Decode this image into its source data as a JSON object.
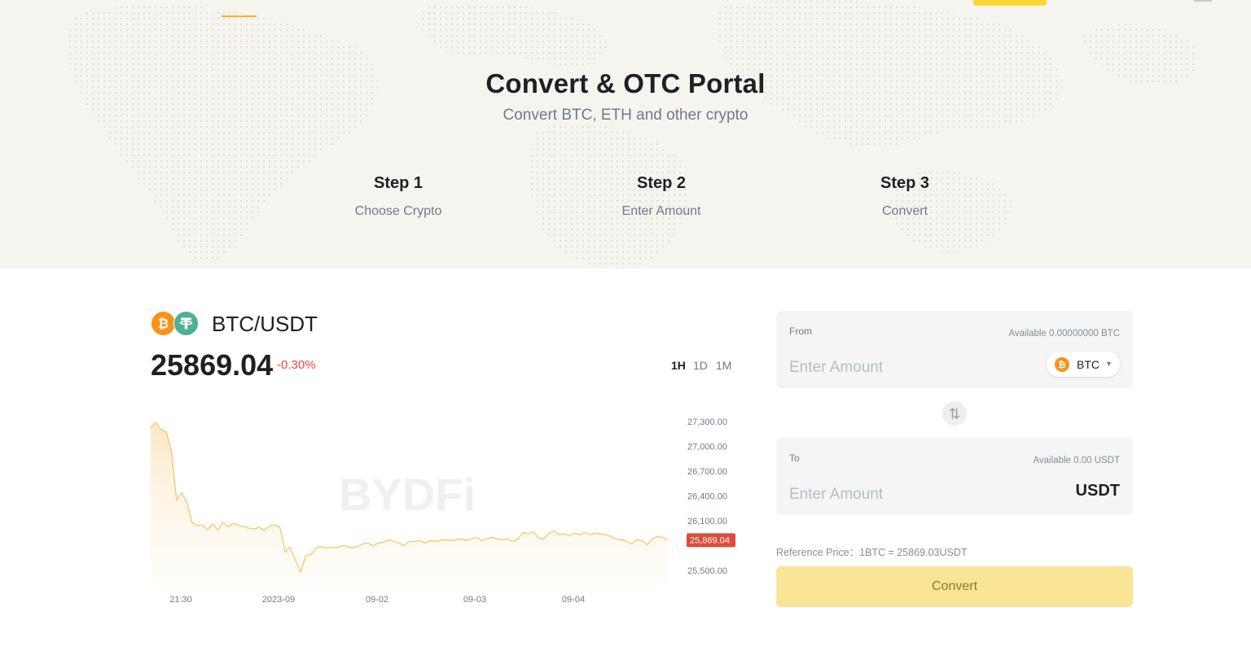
{
  "hero": {
    "title": "Convert & OTC Portal",
    "subtitle": "Convert BTC, ETH and other crypto",
    "steps": [
      {
        "title": "Step 1",
        "desc": "Choose Crypto"
      },
      {
        "title": "Step 2",
        "desc": "Enter Amount"
      },
      {
        "title": "Step 3",
        "desc": "Convert"
      }
    ]
  },
  "pair": {
    "name": "BTC/USDT",
    "price": "25869.04",
    "change": "-0.30%",
    "base_icon": "btc-coin-icon",
    "quote_icon": "usdt-coin-icon"
  },
  "timeframes": [
    "1H",
    "1D",
    "1M"
  ],
  "chart_data": {
    "type": "area",
    "watermark": "BYDFi",
    "x_ticks": [
      "21:30",
      "2023-09",
      "09-02",
      "09-03",
      "09-04"
    ],
    "y_ticks": [
      27300,
      27000,
      26700,
      26400,
      26100,
      25500
    ],
    "y_tick_labels": [
      "27,300.00",
      "27,000.00",
      "26,700.00",
      "26,400.00",
      "26,100.00",
      "25,500.00"
    ],
    "ylim": [
      25430,
      27400
    ],
    "current_label": "25,869.04",
    "current_value": 25869.04,
    "color": "#f7c568",
    "values": [
      27230,
      27290,
      27200,
      27180,
      26950,
      26350,
      26440,
      26320,
      26080,
      26040,
      26050,
      25990,
      26060,
      25990,
      26080,
      26030,
      26070,
      26040,
      26030,
      26010,
      26000,
      26020,
      25980,
      26040,
      26050,
      26020,
      25720,
      25780,
      25620,
      25480,
      25680,
      25690,
      25770,
      25790,
      25770,
      25780,
      25770,
      25800,
      25790,
      25770,
      25790,
      25820,
      25830,
      25800,
      25830,
      25840,
      25870,
      25850,
      25830,
      25800,
      25850,
      25850,
      25860,
      25830,
      25860,
      25850,
      25860,
      25870,
      25860,
      25870,
      25880,
      25860,
      25880,
      25900,
      25860,
      25880,
      25900,
      25880,
      25870,
      25880,
      25850,
      25880,
      25960,
      25940,
      25970,
      25890,
      25880,
      25950,
      25980,
      25930,
      25940,
      25920,
      25950,
      25930,
      25960,
      25930,
      25950,
      25940,
      25930,
      25910,
      25880,
      25870,
      25850,
      25820,
      25870,
      25860,
      25810,
      25880,
      25910,
      25900,
      25869
    ]
  },
  "convert": {
    "from_label": "From",
    "from_available": "Available 0.00000000 BTC",
    "from_placeholder": "Enter Amount",
    "from_coin": "BTC",
    "to_label": "To",
    "to_available": "Available 0.00 USDT",
    "to_placeholder": "Enter Amount",
    "to_coin": "USDT",
    "reference_price": "Reference Price：1BTC = 25869.03USDT",
    "button_label": "Convert",
    "swap_icon": "swap-arrows-icon"
  },
  "colors": {
    "accent": "#fcd535",
    "button": "#fae596",
    "negative": "#e04a3c",
    "hero_bg": "#f5f4ef"
  }
}
